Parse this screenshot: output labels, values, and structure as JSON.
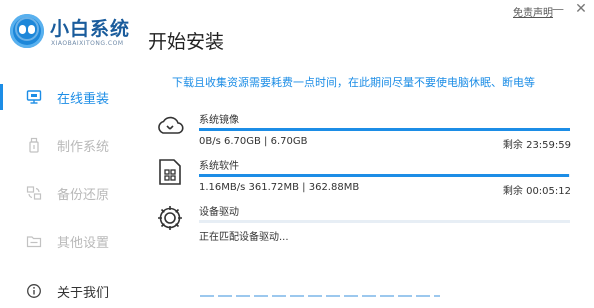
{
  "brand": {
    "name": "小白系统",
    "url": "XIAOBAIXITONG.COM",
    "accent_color": "#1d87d9"
  },
  "header": {
    "page_title": "开始安装",
    "disclaimer_link": "免责声明",
    "minimize_glyph": "—",
    "close_glyph": "✕"
  },
  "sidebar": {
    "items": [
      {
        "label": "在线重装",
        "icon": "monitor-icon",
        "state": "active"
      },
      {
        "label": "制作系统",
        "icon": "usb-drive-icon",
        "state": "disabled"
      },
      {
        "label": "备份还原",
        "icon": "backup-restore-icon",
        "state": "disabled"
      },
      {
        "label": "其他设置",
        "icon": "settings-folder-icon",
        "state": "disabled"
      },
      {
        "label": "关于我们",
        "icon": "info-circle-icon",
        "state": "normal"
      }
    ]
  },
  "main": {
    "notice": "下载且收集资源需要耗费一点时间，在此期间尽量不要使电脑休眠、断电等",
    "tasks": [
      {
        "name": "系统镜像",
        "icon": "cloud-download-icon",
        "size_text": "0B/s 6.70GB | 6.70GB",
        "remain_text": "剩余 23:59:59",
        "progress": 1.0
      },
      {
        "name": "系统软件",
        "icon": "software-package-icon",
        "size_text": "1.16MB/s 361.72MB | 362.88MB",
        "remain_text": "剩余 00:05:12",
        "progress": 0.997
      },
      {
        "name": "设备驱动",
        "icon": "driver-gear-icon",
        "status_text": "正在匹配设备驱动...",
        "progress": 0.0
      }
    ]
  },
  "colors": {
    "primary": "#1c8de6",
    "bar_track": "#e7eef5",
    "disabled_text": "#b9b9b9"
  }
}
